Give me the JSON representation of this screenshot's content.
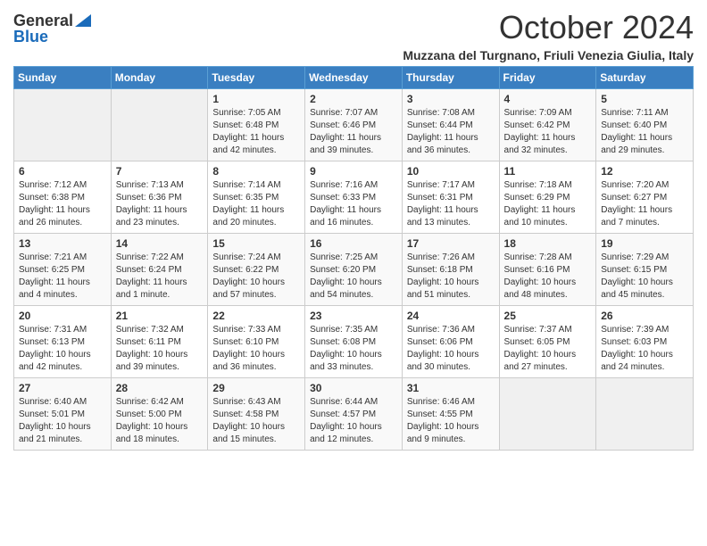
{
  "logo": {
    "general": "General",
    "blue": "Blue"
  },
  "title": "October 2024",
  "location": "Muzzana del Turgnano, Friuli Venezia Giulia, Italy",
  "days_of_week": [
    "Sunday",
    "Monday",
    "Tuesday",
    "Wednesday",
    "Thursday",
    "Friday",
    "Saturday"
  ],
  "weeks": [
    [
      {
        "num": "",
        "info": ""
      },
      {
        "num": "",
        "info": ""
      },
      {
        "num": "1",
        "info": "Sunrise: 7:05 AM\nSunset: 6:48 PM\nDaylight: 11 hours and 42 minutes."
      },
      {
        "num": "2",
        "info": "Sunrise: 7:07 AM\nSunset: 6:46 PM\nDaylight: 11 hours and 39 minutes."
      },
      {
        "num": "3",
        "info": "Sunrise: 7:08 AM\nSunset: 6:44 PM\nDaylight: 11 hours and 36 minutes."
      },
      {
        "num": "4",
        "info": "Sunrise: 7:09 AM\nSunset: 6:42 PM\nDaylight: 11 hours and 32 minutes."
      },
      {
        "num": "5",
        "info": "Sunrise: 7:11 AM\nSunset: 6:40 PM\nDaylight: 11 hours and 29 minutes."
      }
    ],
    [
      {
        "num": "6",
        "info": "Sunrise: 7:12 AM\nSunset: 6:38 PM\nDaylight: 11 hours and 26 minutes."
      },
      {
        "num": "7",
        "info": "Sunrise: 7:13 AM\nSunset: 6:36 PM\nDaylight: 11 hours and 23 minutes."
      },
      {
        "num": "8",
        "info": "Sunrise: 7:14 AM\nSunset: 6:35 PM\nDaylight: 11 hours and 20 minutes."
      },
      {
        "num": "9",
        "info": "Sunrise: 7:16 AM\nSunset: 6:33 PM\nDaylight: 11 hours and 16 minutes."
      },
      {
        "num": "10",
        "info": "Sunrise: 7:17 AM\nSunset: 6:31 PM\nDaylight: 11 hours and 13 minutes."
      },
      {
        "num": "11",
        "info": "Sunrise: 7:18 AM\nSunset: 6:29 PM\nDaylight: 11 hours and 10 minutes."
      },
      {
        "num": "12",
        "info": "Sunrise: 7:20 AM\nSunset: 6:27 PM\nDaylight: 11 hours and 7 minutes."
      }
    ],
    [
      {
        "num": "13",
        "info": "Sunrise: 7:21 AM\nSunset: 6:25 PM\nDaylight: 11 hours and 4 minutes."
      },
      {
        "num": "14",
        "info": "Sunrise: 7:22 AM\nSunset: 6:24 PM\nDaylight: 11 hours and 1 minute."
      },
      {
        "num": "15",
        "info": "Sunrise: 7:24 AM\nSunset: 6:22 PM\nDaylight: 10 hours and 57 minutes."
      },
      {
        "num": "16",
        "info": "Sunrise: 7:25 AM\nSunset: 6:20 PM\nDaylight: 10 hours and 54 minutes."
      },
      {
        "num": "17",
        "info": "Sunrise: 7:26 AM\nSunset: 6:18 PM\nDaylight: 10 hours and 51 minutes."
      },
      {
        "num": "18",
        "info": "Sunrise: 7:28 AM\nSunset: 6:16 PM\nDaylight: 10 hours and 48 minutes."
      },
      {
        "num": "19",
        "info": "Sunrise: 7:29 AM\nSunset: 6:15 PM\nDaylight: 10 hours and 45 minutes."
      }
    ],
    [
      {
        "num": "20",
        "info": "Sunrise: 7:31 AM\nSunset: 6:13 PM\nDaylight: 10 hours and 42 minutes."
      },
      {
        "num": "21",
        "info": "Sunrise: 7:32 AM\nSunset: 6:11 PM\nDaylight: 10 hours and 39 minutes."
      },
      {
        "num": "22",
        "info": "Sunrise: 7:33 AM\nSunset: 6:10 PM\nDaylight: 10 hours and 36 minutes."
      },
      {
        "num": "23",
        "info": "Sunrise: 7:35 AM\nSunset: 6:08 PM\nDaylight: 10 hours and 33 minutes."
      },
      {
        "num": "24",
        "info": "Sunrise: 7:36 AM\nSunset: 6:06 PM\nDaylight: 10 hours and 30 minutes."
      },
      {
        "num": "25",
        "info": "Sunrise: 7:37 AM\nSunset: 6:05 PM\nDaylight: 10 hours and 27 minutes."
      },
      {
        "num": "26",
        "info": "Sunrise: 7:39 AM\nSunset: 6:03 PM\nDaylight: 10 hours and 24 minutes."
      }
    ],
    [
      {
        "num": "27",
        "info": "Sunrise: 6:40 AM\nSunset: 5:01 PM\nDaylight: 10 hours and 21 minutes."
      },
      {
        "num": "28",
        "info": "Sunrise: 6:42 AM\nSunset: 5:00 PM\nDaylight: 10 hours and 18 minutes."
      },
      {
        "num": "29",
        "info": "Sunrise: 6:43 AM\nSunset: 4:58 PM\nDaylight: 10 hours and 15 minutes."
      },
      {
        "num": "30",
        "info": "Sunrise: 6:44 AM\nSunset: 4:57 PM\nDaylight: 10 hours and 12 minutes."
      },
      {
        "num": "31",
        "info": "Sunrise: 6:46 AM\nSunset: 4:55 PM\nDaylight: 10 hours and 9 minutes."
      },
      {
        "num": "",
        "info": ""
      },
      {
        "num": "",
        "info": ""
      }
    ]
  ]
}
